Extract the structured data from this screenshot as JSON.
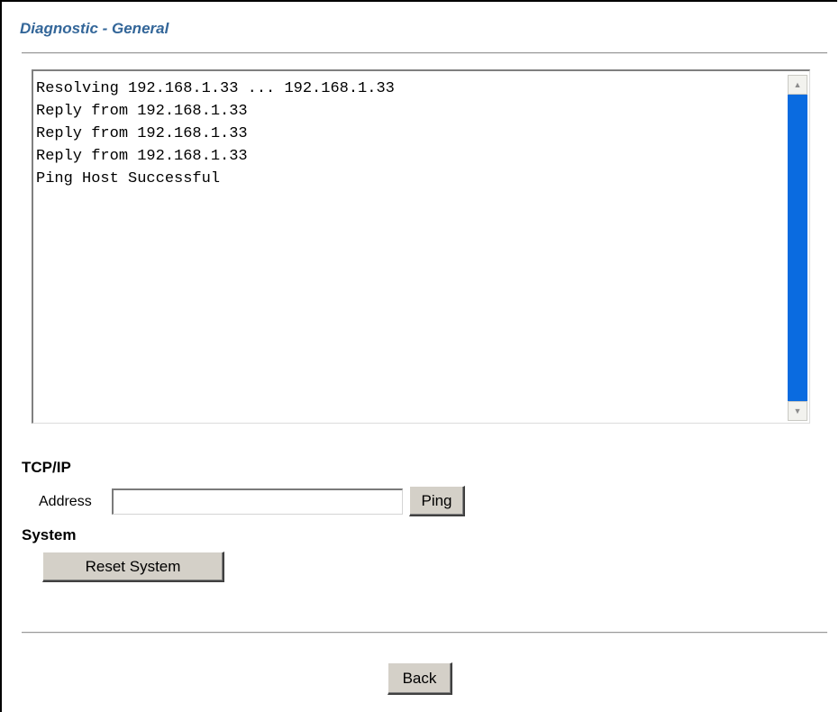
{
  "header": {
    "title": "Diagnostic - General"
  },
  "output": {
    "lines": [
      "Resolving 192.168.1.33 ... 192.168.1.33",
      "Reply from 192.168.1.33",
      "Reply from 192.168.1.33",
      "Reply from 192.168.1.33",
      "Ping Host Successful"
    ],
    "scroll_up_icon": "arrow-up-icon",
    "scroll_down_icon": "arrow-down-icon"
  },
  "tcpip": {
    "heading": "TCP/IP",
    "address_label": "Address",
    "address_value": "",
    "ping_label": "Ping"
  },
  "system": {
    "heading": "System",
    "reset_label": "Reset System"
  },
  "footer": {
    "back_label": "Back"
  },
  "colors": {
    "title": "#336699",
    "scrollbar": "#0a6be0",
    "button_face": "#d4d0c8"
  }
}
